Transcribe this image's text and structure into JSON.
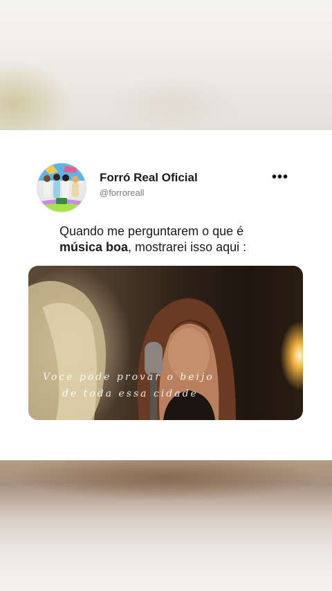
{
  "post": {
    "author": {
      "name": "Forró Real Oficial",
      "handle": "@forroreall"
    },
    "more_icon": "ellipsis-icon",
    "caption": {
      "line1": "Quando me perguntarem o que é",
      "bold": "música boa",
      "rest": ", mostrarei isso aqui :"
    },
    "video": {
      "lyrics_line1": "Voce   pode  provar  o  beijo",
      "lyrics_line2": "de  toda  essa  cidade"
    }
  },
  "colors": {
    "background": "#ffffff",
    "text": "#1a1a1a",
    "handle": "#7a7a7a"
  }
}
